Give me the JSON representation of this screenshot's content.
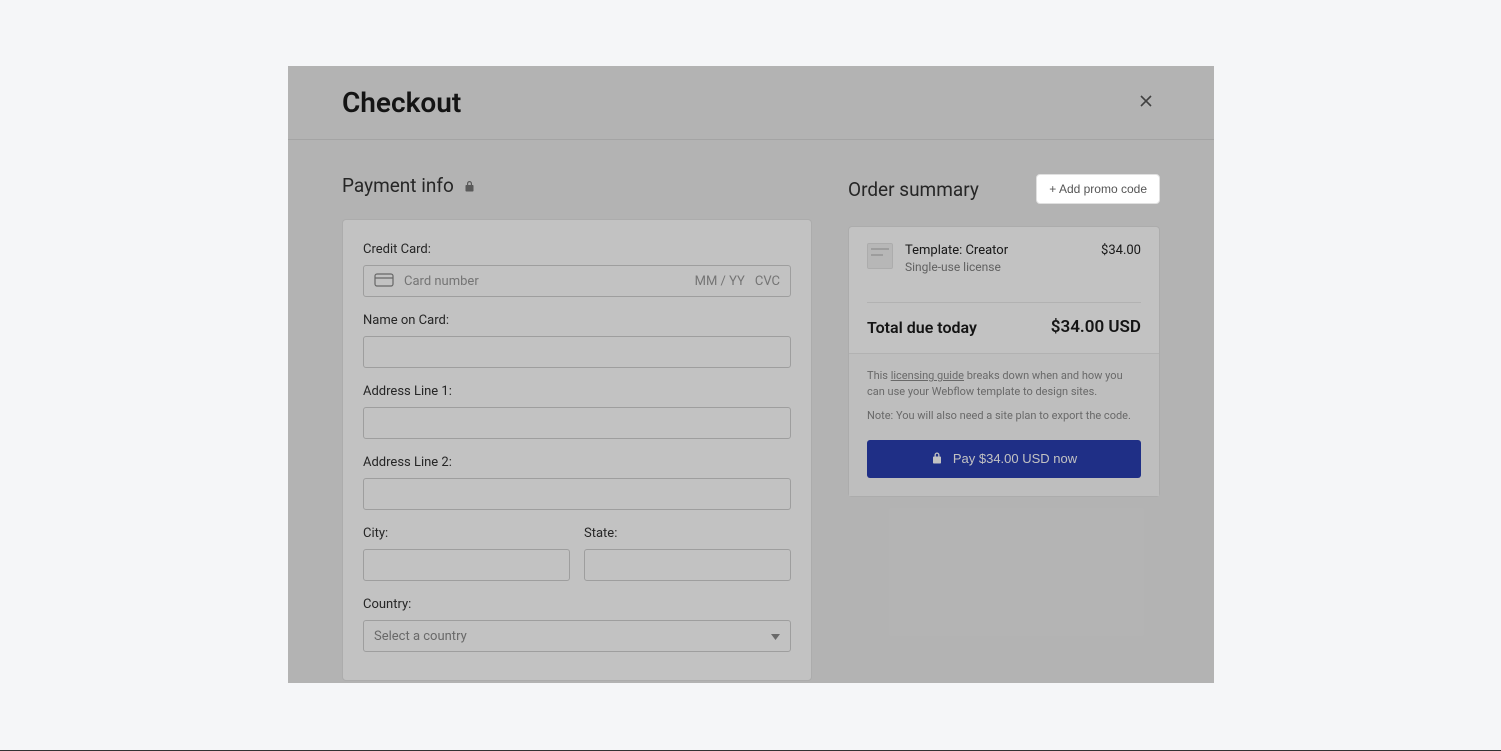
{
  "modal": {
    "title": "Checkout"
  },
  "payment": {
    "heading": "Payment info",
    "labels": {
      "credit_card": "Credit Card:",
      "name_on_card": "Name on Card:",
      "address1": "Address Line 1:",
      "address2": "Address Line 2:",
      "city": "City:",
      "state": "State:",
      "country": "Country:"
    },
    "placeholders": {
      "card_number": "Card number",
      "exp": "MM / YY",
      "cvc": "CVC",
      "country": "Select a country"
    }
  },
  "summary": {
    "heading": "Order summary",
    "promo_label": "+ Add promo code",
    "item": {
      "name": "Template: Creator",
      "sub": "Single-use license",
      "price": "$34.00"
    },
    "total_label": "Total due today",
    "total_value": "$34.00 USD",
    "footnote1_pre": "This ",
    "footnote1_link": "licensing guide",
    "footnote1_post": " breaks down when and how you can use your Webflow template to design sites.",
    "footnote2": "Note: You will also need a site plan to export the code.",
    "pay_label": "Pay $34.00 USD now"
  }
}
